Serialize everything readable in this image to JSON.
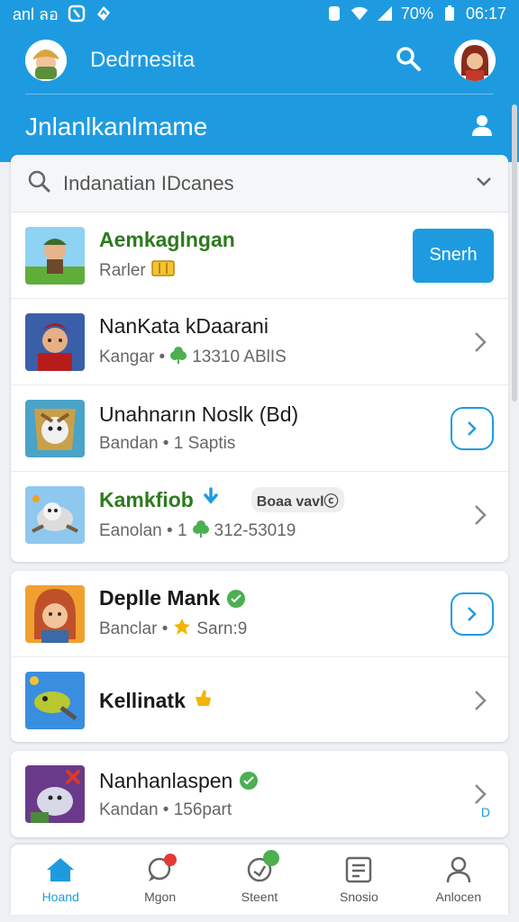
{
  "status_bar": {
    "carrier": "anl ลอ",
    "battery": "70%",
    "time": "06:17"
  },
  "header": {
    "app_title": "Dedrnesita",
    "page_title": "Jnlanlkanlmame"
  },
  "search": {
    "text": "Indanatian IDcanes"
  },
  "group1": [
    {
      "title": "Aemkaglngan",
      "subtitle": "Rarler",
      "style": "green",
      "action": "Snerh",
      "action_type": "button"
    },
    {
      "title": "NanKata kDaarani",
      "subtitle": "Kangar • ",
      "subtitle2": "13310 ABlIS",
      "action_type": "chevron"
    },
    {
      "title": "Unahnarın Noslk (Bd)",
      "subtitle": "Bandan • 1 Saptis",
      "action_type": "circle"
    },
    {
      "title": "Kamkfiob",
      "subtitle": "Eanolan • 1 ",
      "subtitle2": "312-53019",
      "style": "green",
      "tag": "Boaa vavlⓒ",
      "action_type": "chevron"
    }
  ],
  "group2": [
    {
      "title": "Deplle Mank",
      "subtitle": "Banclar • ",
      "subtitle2": "Sarn:9",
      "style": "bold",
      "action_type": "circle"
    },
    {
      "title": "Kellinatk",
      "subtitle": "",
      "style": "bold",
      "action_type": "chevron"
    }
  ],
  "group3": [
    {
      "title": "Nanhanlaspen",
      "subtitle": "Kandan • 156part",
      "action_type": "chevron",
      "extra": "D"
    }
  ],
  "bottom_nav": [
    {
      "label": "Hoand",
      "icon": "home-icon",
      "active": true
    },
    {
      "label": "Mgon",
      "icon": "chat-icon",
      "active": false
    },
    {
      "label": "Steent",
      "icon": "refresh-icon",
      "active": false
    },
    {
      "label": "Snosio",
      "icon": "list-icon",
      "active": false
    },
    {
      "label": "Anlocen",
      "icon": "person-icon",
      "active": false
    }
  ],
  "colors": {
    "primary": "#1e9be0",
    "green": "#4caf50"
  }
}
